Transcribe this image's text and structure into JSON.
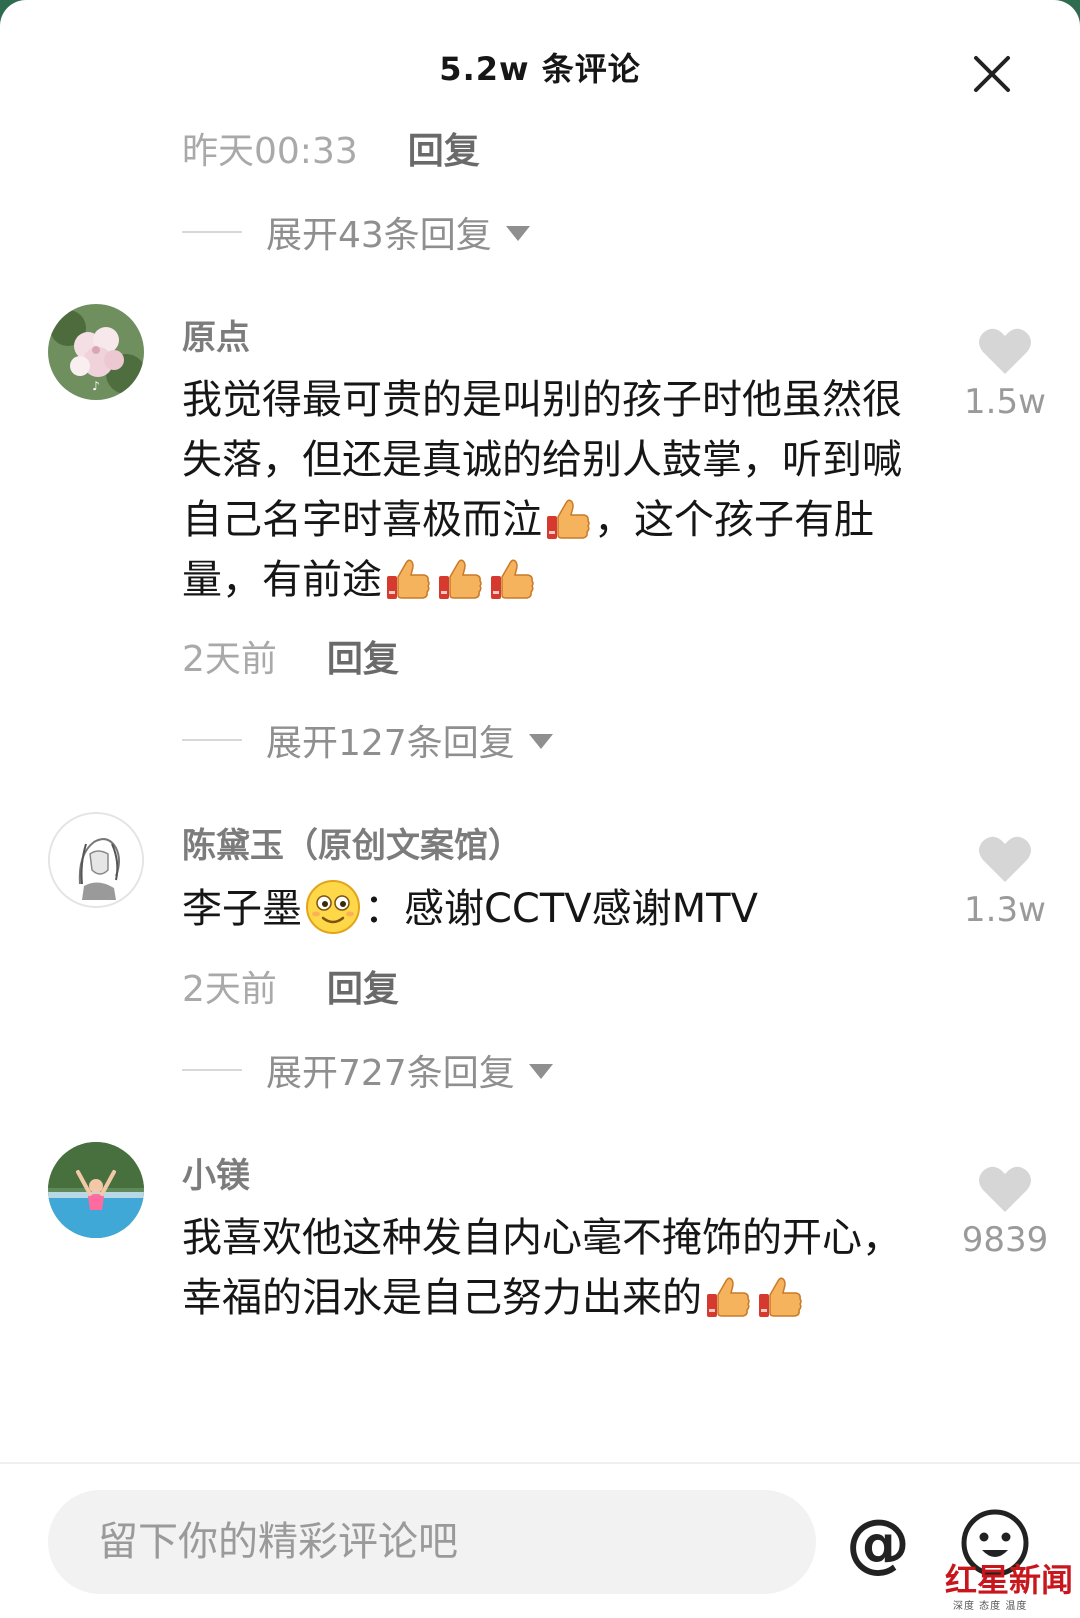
{
  "header": {
    "title": "5.2w 条评论",
    "close_icon": "close-icon"
  },
  "top_thread": {
    "time": "昨天00:33",
    "reply_label": "回复",
    "expand_text": "展开43条回复"
  },
  "comments": [
    {
      "username": "原点",
      "text_parts": [
        "我觉得最可贵的是叫别的孩子时他虽然很失落，但还是真诚的给别人鼓掌，听到喊自己名字时喜极而泣",
        "，这个孩子有肚量，有前途"
      ],
      "emoji": "thumbs-up-icon",
      "time": "2天前",
      "reply_label": "回复",
      "likes": "1.5w",
      "expand_text": "展开127条回复"
    },
    {
      "username": "陈黛玉（原创文案馆）",
      "text_parts": [
        "李子墨",
        "：感谢CCTV感谢MTV"
      ],
      "emoji": "smiling-face-icon",
      "time": "2天前",
      "reply_label": "回复",
      "likes": "1.3w",
      "expand_text": "展开727条回复"
    },
    {
      "username": "小镁",
      "text_parts": [
        "我喜欢他这种发自内心毫不掩饰的开心，幸福的泪水是自己努力出来的"
      ],
      "emoji": "thumbs-up-icon",
      "likes": "9839"
    }
  ],
  "input": {
    "placeholder": "留下你的精彩评论吧",
    "at_label": "@",
    "emoji_icon": "emoji-face-icon"
  },
  "watermark": {
    "main": "红星新闻",
    "sub": "深度 态度 温度"
  },
  "colors": {
    "background_top": "#2f6b4f",
    "sheet": "#ffffff",
    "text_primary": "#161616",
    "text_secondary": "#a9a9a9",
    "heart": "#d6d6d6",
    "watermark_red": "#c8161d"
  }
}
